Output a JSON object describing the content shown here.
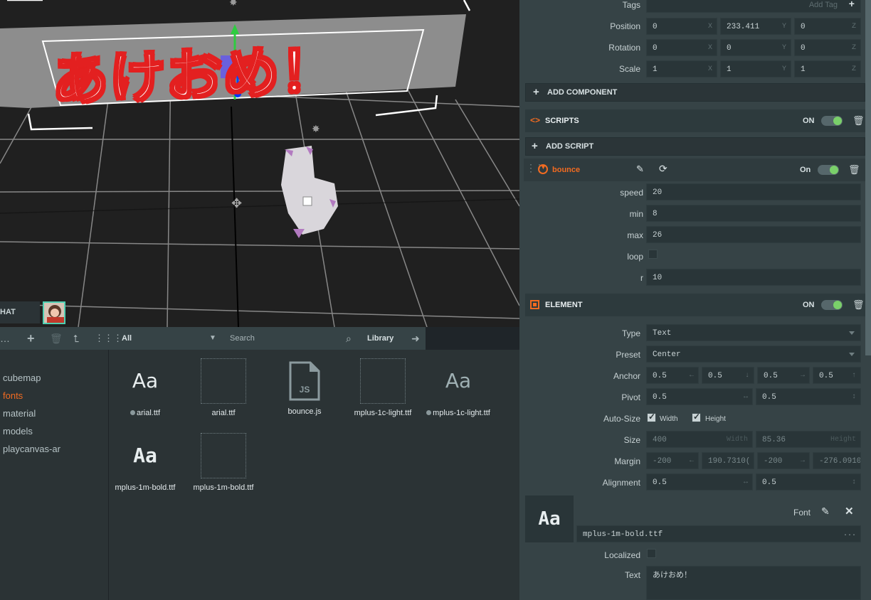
{
  "viewport": {
    "banner_text": "あけおめ！",
    "chat_tab": "HAT"
  },
  "assets": {
    "toolbar": {
      "filter_value": "All",
      "search_placeholder": "Search",
      "library_label": "Library"
    },
    "tree": [
      "cubemap",
      "fonts",
      "material",
      "models",
      "playcanvas-ar"
    ],
    "tree_selected": "fonts",
    "items": [
      {
        "name": "arial.ttf",
        "kind": "font-preview",
        "preview": "Aa",
        "dot": true
      },
      {
        "name": "arial.ttf",
        "kind": "empty"
      },
      {
        "name": "bounce.js",
        "kind": "script",
        "badge": "JS"
      },
      {
        "name": "mplus-1c-light.ttf",
        "kind": "empty"
      },
      {
        "name": "mplus-1c-light.ttf",
        "kind": "font-preview",
        "preview": "Aa",
        "dot": true
      },
      {
        "name": "mplus-1m-bold.ttf",
        "kind": "font-preview",
        "preview": "Aa"
      },
      {
        "name": "mplus-1m-bold.ttf",
        "kind": "empty"
      }
    ]
  },
  "inspector": {
    "tags": {
      "label": "Tags",
      "placeholder": "Add Tag"
    },
    "position": {
      "label": "Position",
      "x": "0",
      "y": "233.411",
      "z": "0"
    },
    "rotation": {
      "label": "Rotation",
      "x": "0",
      "y": "0",
      "z": "0"
    },
    "scale": {
      "label": "Scale",
      "x": "1",
      "y": "1",
      "z": "1"
    },
    "axis": {
      "x": "X",
      "y": "Y",
      "z": "Z"
    },
    "add_component": "ADD COMPONENT",
    "scripts": {
      "title": "SCRIPTS",
      "on": "ON",
      "add_script": "ADD SCRIPT",
      "script_name": "bounce",
      "script_on": "On",
      "attrs": [
        {
          "label": "speed",
          "value": "20"
        },
        {
          "label": "min",
          "value": "8"
        },
        {
          "label": "max",
          "value": "26"
        },
        {
          "label": "loop",
          "value": ""
        },
        {
          "label": "r",
          "value": "10"
        }
      ]
    },
    "element": {
      "title": "ELEMENT",
      "on": "ON",
      "type": {
        "label": "Type",
        "value": "Text"
      },
      "preset": {
        "label": "Preset",
        "value": "Center"
      },
      "anchor": {
        "label": "Anchor",
        "values": [
          "0.5",
          "0.5",
          "0.5",
          "0.5"
        ]
      },
      "pivot": {
        "label": "Pivot",
        "values": [
          "0.5",
          "0.5"
        ]
      },
      "autosize": {
        "label": "Auto-Size",
        "width": "Width",
        "height": "Height"
      },
      "size": {
        "label": "Size",
        "width": "400",
        "width_hint": "Width",
        "height": "85.36",
        "height_hint": "Height"
      },
      "margin": {
        "label": "Margin",
        "values": [
          "-200",
          "190.7310(",
          "-200",
          "-276.0910("
        ]
      },
      "alignment": {
        "label": "Alignment",
        "values": [
          "0.5",
          "0.5"
        ]
      },
      "font": {
        "label": "Font",
        "preview": "Aa",
        "value": "mplus-1m-bold.ttf",
        "more": "..."
      },
      "localized": {
        "label": "Localized"
      },
      "text": {
        "label": "Text",
        "value": "あけおめ！"
      }
    }
  },
  "colors": {
    "accent": "#f26b21",
    "toggle_on": "#7ad06a",
    "panel": "#364346"
  }
}
